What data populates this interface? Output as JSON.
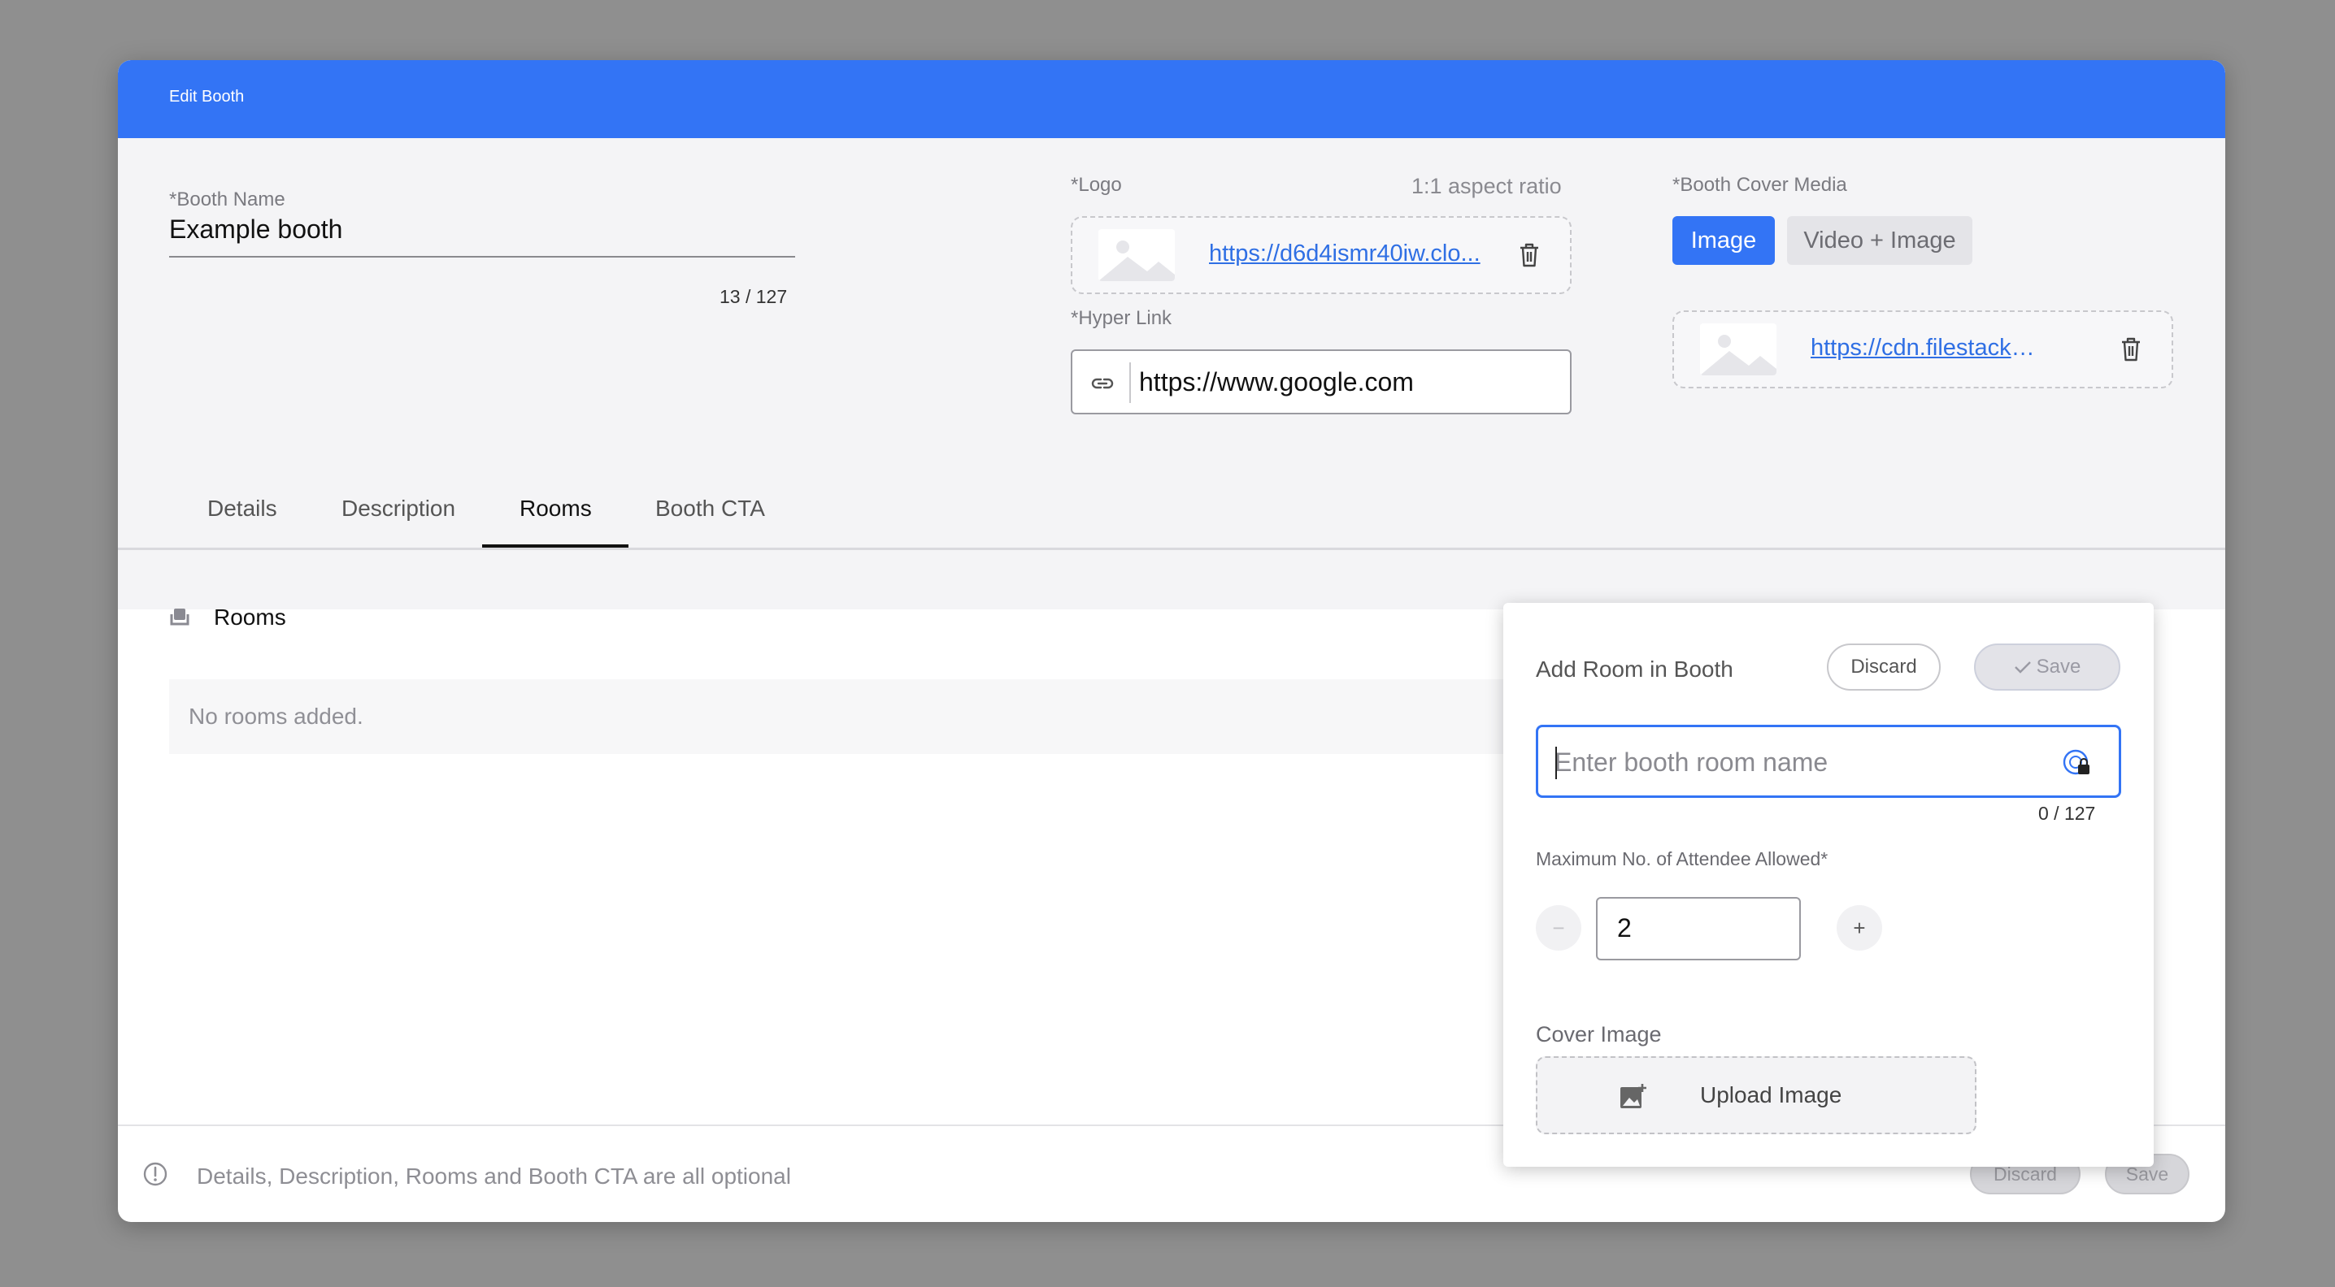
{
  "modal": {
    "title": "Edit Booth",
    "header_color": "#3374f5"
  },
  "booth_name": {
    "label": "*Booth Name",
    "value": "Example booth",
    "count": "13 / 127"
  },
  "logo": {
    "label": "*Logo",
    "hint": "1:1 aspect ratio",
    "url": "https://d6d4ismr40iw.clo..."
  },
  "hyper_link": {
    "label": "*Hyper Link",
    "value": "https://www.google.com"
  },
  "cover_media": {
    "label": "*Booth Cover Media",
    "options": [
      "Image",
      "Video + Image"
    ],
    "selected": "Image",
    "url": "https://cdn.filestackconte..."
  },
  "tabs": [
    {
      "label": "Details"
    },
    {
      "label": "Description"
    },
    {
      "label": "Rooms"
    },
    {
      "label": "Booth CTA"
    }
  ],
  "active_tab": "Rooms",
  "rooms": {
    "heading": "Rooms",
    "empty_text": "No rooms added."
  },
  "add_room": {
    "title": "Add Room in Booth",
    "discard_label": "Discard",
    "save_label": "Save",
    "name_placeholder": "Enter booth room name",
    "name_count": "0 / 127",
    "max_label": "Maximum No. of Attendee Allowed*",
    "max_value": "2",
    "decrement_symbol": "−",
    "increment_symbol": "+",
    "cover_label": "Cover Image",
    "upload_label": "Upload Image"
  },
  "footer": {
    "note": "Details, Description, Rooms and Booth CTA are all optional",
    "discard_label": "Discard",
    "save_label": "Save"
  },
  "icons": {
    "link": "link-icon",
    "trash": "trash-icon",
    "image_placeholder": "image-placeholder-icon",
    "rooms": "rooms-icon",
    "info": "info-icon",
    "upload": "add-image-icon",
    "check": "check-icon",
    "password_manager": "password-key-icon"
  }
}
